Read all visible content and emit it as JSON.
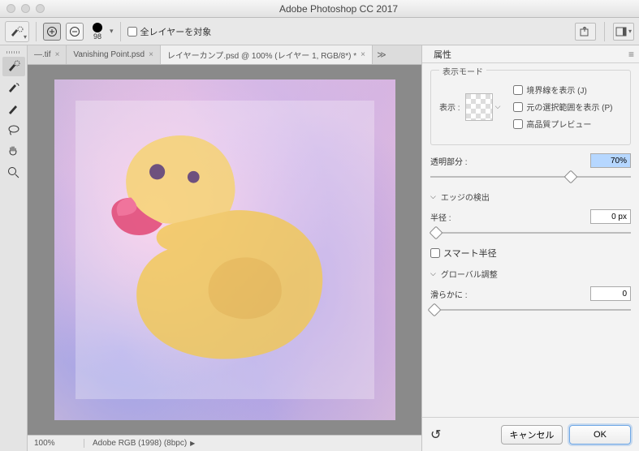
{
  "app_title": "Adobe Photoshop CC 2017",
  "options_bar": {
    "brush_size": "98",
    "all_layers_label": "全レイヤーを対象"
  },
  "tabs": [
    {
      "label": "—.tif",
      "active": false,
      "close": "×"
    },
    {
      "label": "Vanishing Point.psd",
      "active": false,
      "close": "×"
    },
    {
      "label": "レイヤーカンプ.psd @ 100% (レイヤー 1, RGB/8*) *",
      "active": true,
      "close": "×"
    }
  ],
  "tab_overflow": "≫",
  "status": {
    "zoom": "100%",
    "doc_info": "Adobe RGB (1998) (8bpc)"
  },
  "panel": {
    "title": "属性",
    "display_mode": {
      "title": "表示モード",
      "show_label": "表示 :",
      "cb1": "境界線を表示 (J)",
      "cb2": "元の選択範囲を表示 (P)",
      "cb3": "高品質プレビュー"
    },
    "transparency": {
      "label": "透明部分 :",
      "value": "70%"
    },
    "edge": {
      "title": "エッジの検出",
      "radius_label": "半径 :",
      "radius_value": "0 px",
      "smart_label": "スマート半径"
    },
    "global": {
      "title": "グローバル調整",
      "smooth_label": "滑らかに :",
      "smooth_value": "0"
    },
    "reset": "↺",
    "cancel": "キャンセル",
    "ok": "OK"
  }
}
